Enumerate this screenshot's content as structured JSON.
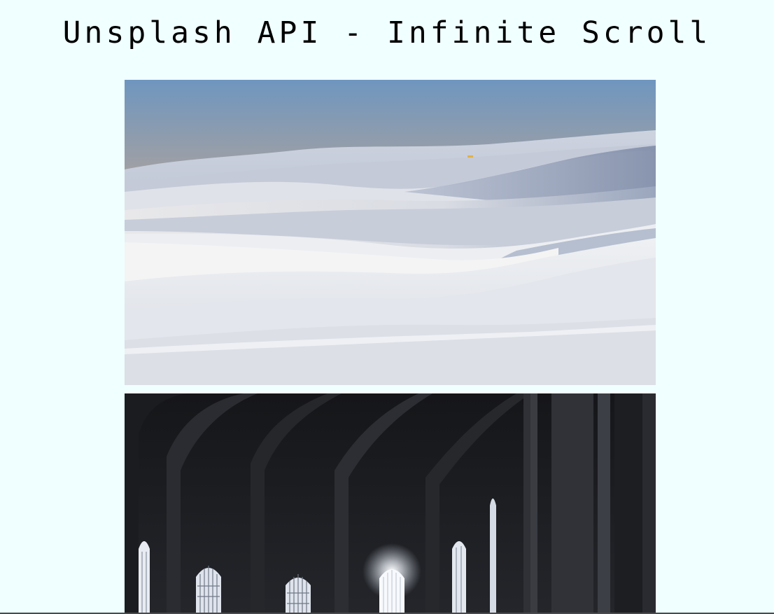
{
  "header": {
    "title": "Unsplash API - Infinite Scroll"
  },
  "feed": {
    "images": [
      {
        "name": "white-sand-dunes-photo",
        "subject": "white sand dunes at dusk"
      },
      {
        "name": "church-interior-photo",
        "subject": "dark cathedral interior with lit arched windows"
      }
    ]
  },
  "colors": {
    "page_background": "#f0ffff",
    "title_text": "#000000"
  }
}
